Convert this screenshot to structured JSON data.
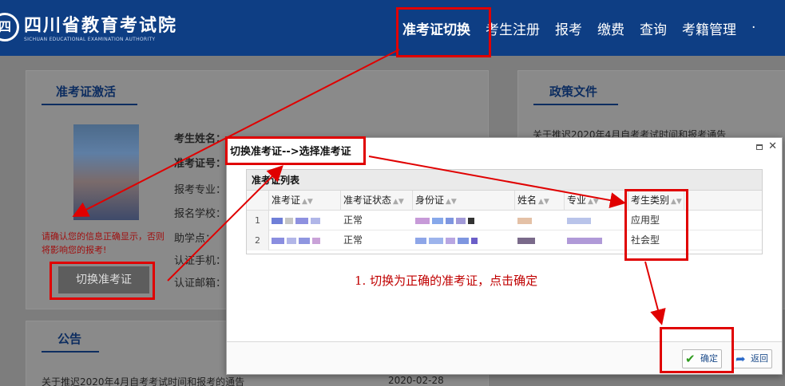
{
  "header": {
    "logo_glyph": "四",
    "site_name": "四川省教育考试院",
    "site_name_en": "SICHUAN EDUCATIONAL EXAMINATION AUTHORITY",
    "nav": [
      {
        "label": "准考证切换",
        "active": true
      },
      {
        "label": "考生注册"
      },
      {
        "label": "报考"
      },
      {
        "label": "缴费"
      },
      {
        "label": "查询"
      },
      {
        "label": "考籍管理"
      },
      {
        "label": "·"
      }
    ]
  },
  "left_panel": {
    "title": "准考证激活",
    "fields": [
      "考生姓名：",
      "准考证号：",
      "报考专业：",
      "报名学校：",
      "助学点：",
      "认证手机：",
      "认证邮箱："
    ],
    "warning": "请确认您的信息正确显示，否则将影响您的报考!",
    "switch_button": "切换准考证"
  },
  "notice_panel": {
    "title": "公告",
    "item_text": "关于推迟2020年4月自考考试时间和报考的通告",
    "item_date": "2020-02-28"
  },
  "policy_panel": {
    "title": "政策文件",
    "item_text": "关于推迟2020年4月自考考试时间和报考通告"
  },
  "dialog": {
    "title": "切换准考证-->选择准考证",
    "grid_title": "准考证列表",
    "columns": [
      "准考证",
      "准考证状态",
      "身份证",
      "姓名",
      "专业",
      "考生类别"
    ],
    "rows": [
      {
        "num": "1",
        "status": "正常",
        "category": "应用型"
      },
      {
        "num": "2",
        "status": "正常",
        "category": "社会型"
      }
    ],
    "instruction": "1. 切换为正确的准考证，点击确定",
    "ok_label": "确定",
    "back_label": "返回"
  },
  "colors": {
    "header_bg": "#0e3e84",
    "annotation_red": "#e00000",
    "ok_icon_green": "#2e9b1e"
  },
  "icons": [
    "logo-icon",
    "maximize-icon",
    "close-icon",
    "sort-icon",
    "check-icon",
    "back-arrow-icon"
  ]
}
